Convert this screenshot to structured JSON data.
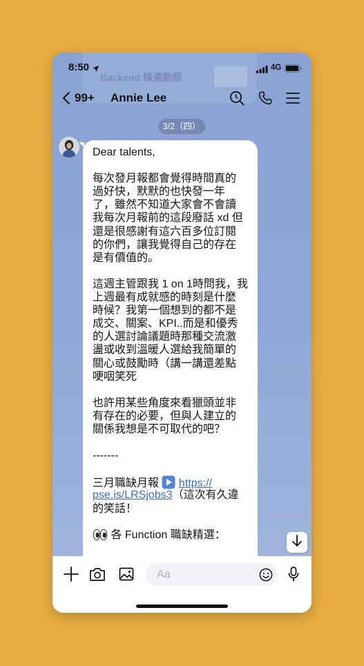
{
  "status_bar": {
    "time": "8:50",
    "network": "4G"
  },
  "ghost_overlay": {
    "title": "Backend 精選動態"
  },
  "header": {
    "back_count": "99+",
    "contact_name": "Annie Lee"
  },
  "date_divider": {
    "label": "3/2（四）"
  },
  "message": {
    "greeting": "Dear talents,",
    "paragraphs": [
      [
        "每次發月報都會覺得時間真的",
        "過好快，默默的也快發一年",
        "了，雖然不知道大家會不會讀",
        "我每次月報前的這段廢話 xd 但",
        "還是很感謝有這六百多位訂閱",
        "的你們，讓我覺得自己的存在",
        "是有價值的。"
      ],
      [
        "這週主管跟我 1 on 1時問我，我",
        "上週最有成就感的時刻是什麼",
        "時候？我第一個想到的都不是",
        "成交、關案、KPI..而是和優秀",
        "的人選討論議題時那種交流激",
        "盪或收到溫暖人選給我簡單的",
        "關心或鼓勵時（講一講還差點",
        "哽咽笑死"
      ],
      [
        "也許用某些角度來看獵頭並非",
        "有存在的必要，但與人建立的",
        "關係我想是不可取代的吧？"
      ]
    ],
    "separator": "-------",
    "report": {
      "prefix": "三月職缺月報",
      "link_line_1": "https://",
      "link_line_2": "pse.is/LRSjobs3",
      "suffix_line_1": "（這次有久違",
      "suffix_line_2": "的笑話！"
    },
    "function_heading": "各 Function 職缺精選："
  },
  "input": {
    "placeholder": "Aa"
  },
  "icons": {
    "status": [
      "location-arrow-icon",
      "signal-icon",
      "battery-icon"
    ],
    "header": [
      "back-chevron-icon",
      "search-icon",
      "phone-icon",
      "menu-icon"
    ],
    "message_emoji": [
      "play-button-emoji",
      "eyes-emoji"
    ],
    "scroll": "arrow-down-icon",
    "input_bar": [
      "plus-icon",
      "camera-icon",
      "image-icon",
      "smiley-icon",
      "microphone-icon"
    ]
  },
  "colors": {
    "page_background": "#E9AD41",
    "chat_background": "#8EA7D6",
    "bubble": "#FFFFFF",
    "link": "#3D6BD6",
    "date_pill": "#7C8DB8"
  }
}
